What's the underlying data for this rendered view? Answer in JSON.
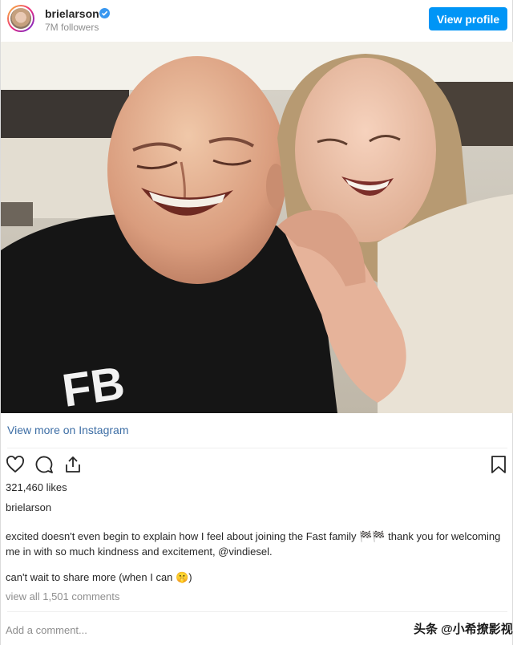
{
  "header": {
    "username": "brielarson",
    "followers": "7M followers",
    "view_profile_label": "View profile"
  },
  "post": {
    "view_more_label": "View more on Instagram",
    "likes": "321,460 likes",
    "caption_user": "brielarson",
    "caption_text": "excited doesn't even begin to explain how I feel about joining the Fast family 🏁🏁 thank you for welcoming me in with so much kindness and excitement, @vindiesel.",
    "caption_text_2": "can't wait to share more (when I can 🤫)",
    "comments_link": "view all 1,501 comments",
    "add_comment_placeholder": "Add a comment..."
  },
  "photo": {
    "shirt_text": "FB"
  },
  "watermark": {
    "text": "头条 @小希撩影视"
  },
  "colors": {
    "accent": "#0095f6",
    "verified": "#3897f0",
    "muted_text": "#8e8e8e",
    "link": "#3d6ea5"
  },
  "icons": [
    "verified-badge-icon",
    "heart-icon",
    "comment-icon",
    "share-icon",
    "bookmark-icon"
  ]
}
